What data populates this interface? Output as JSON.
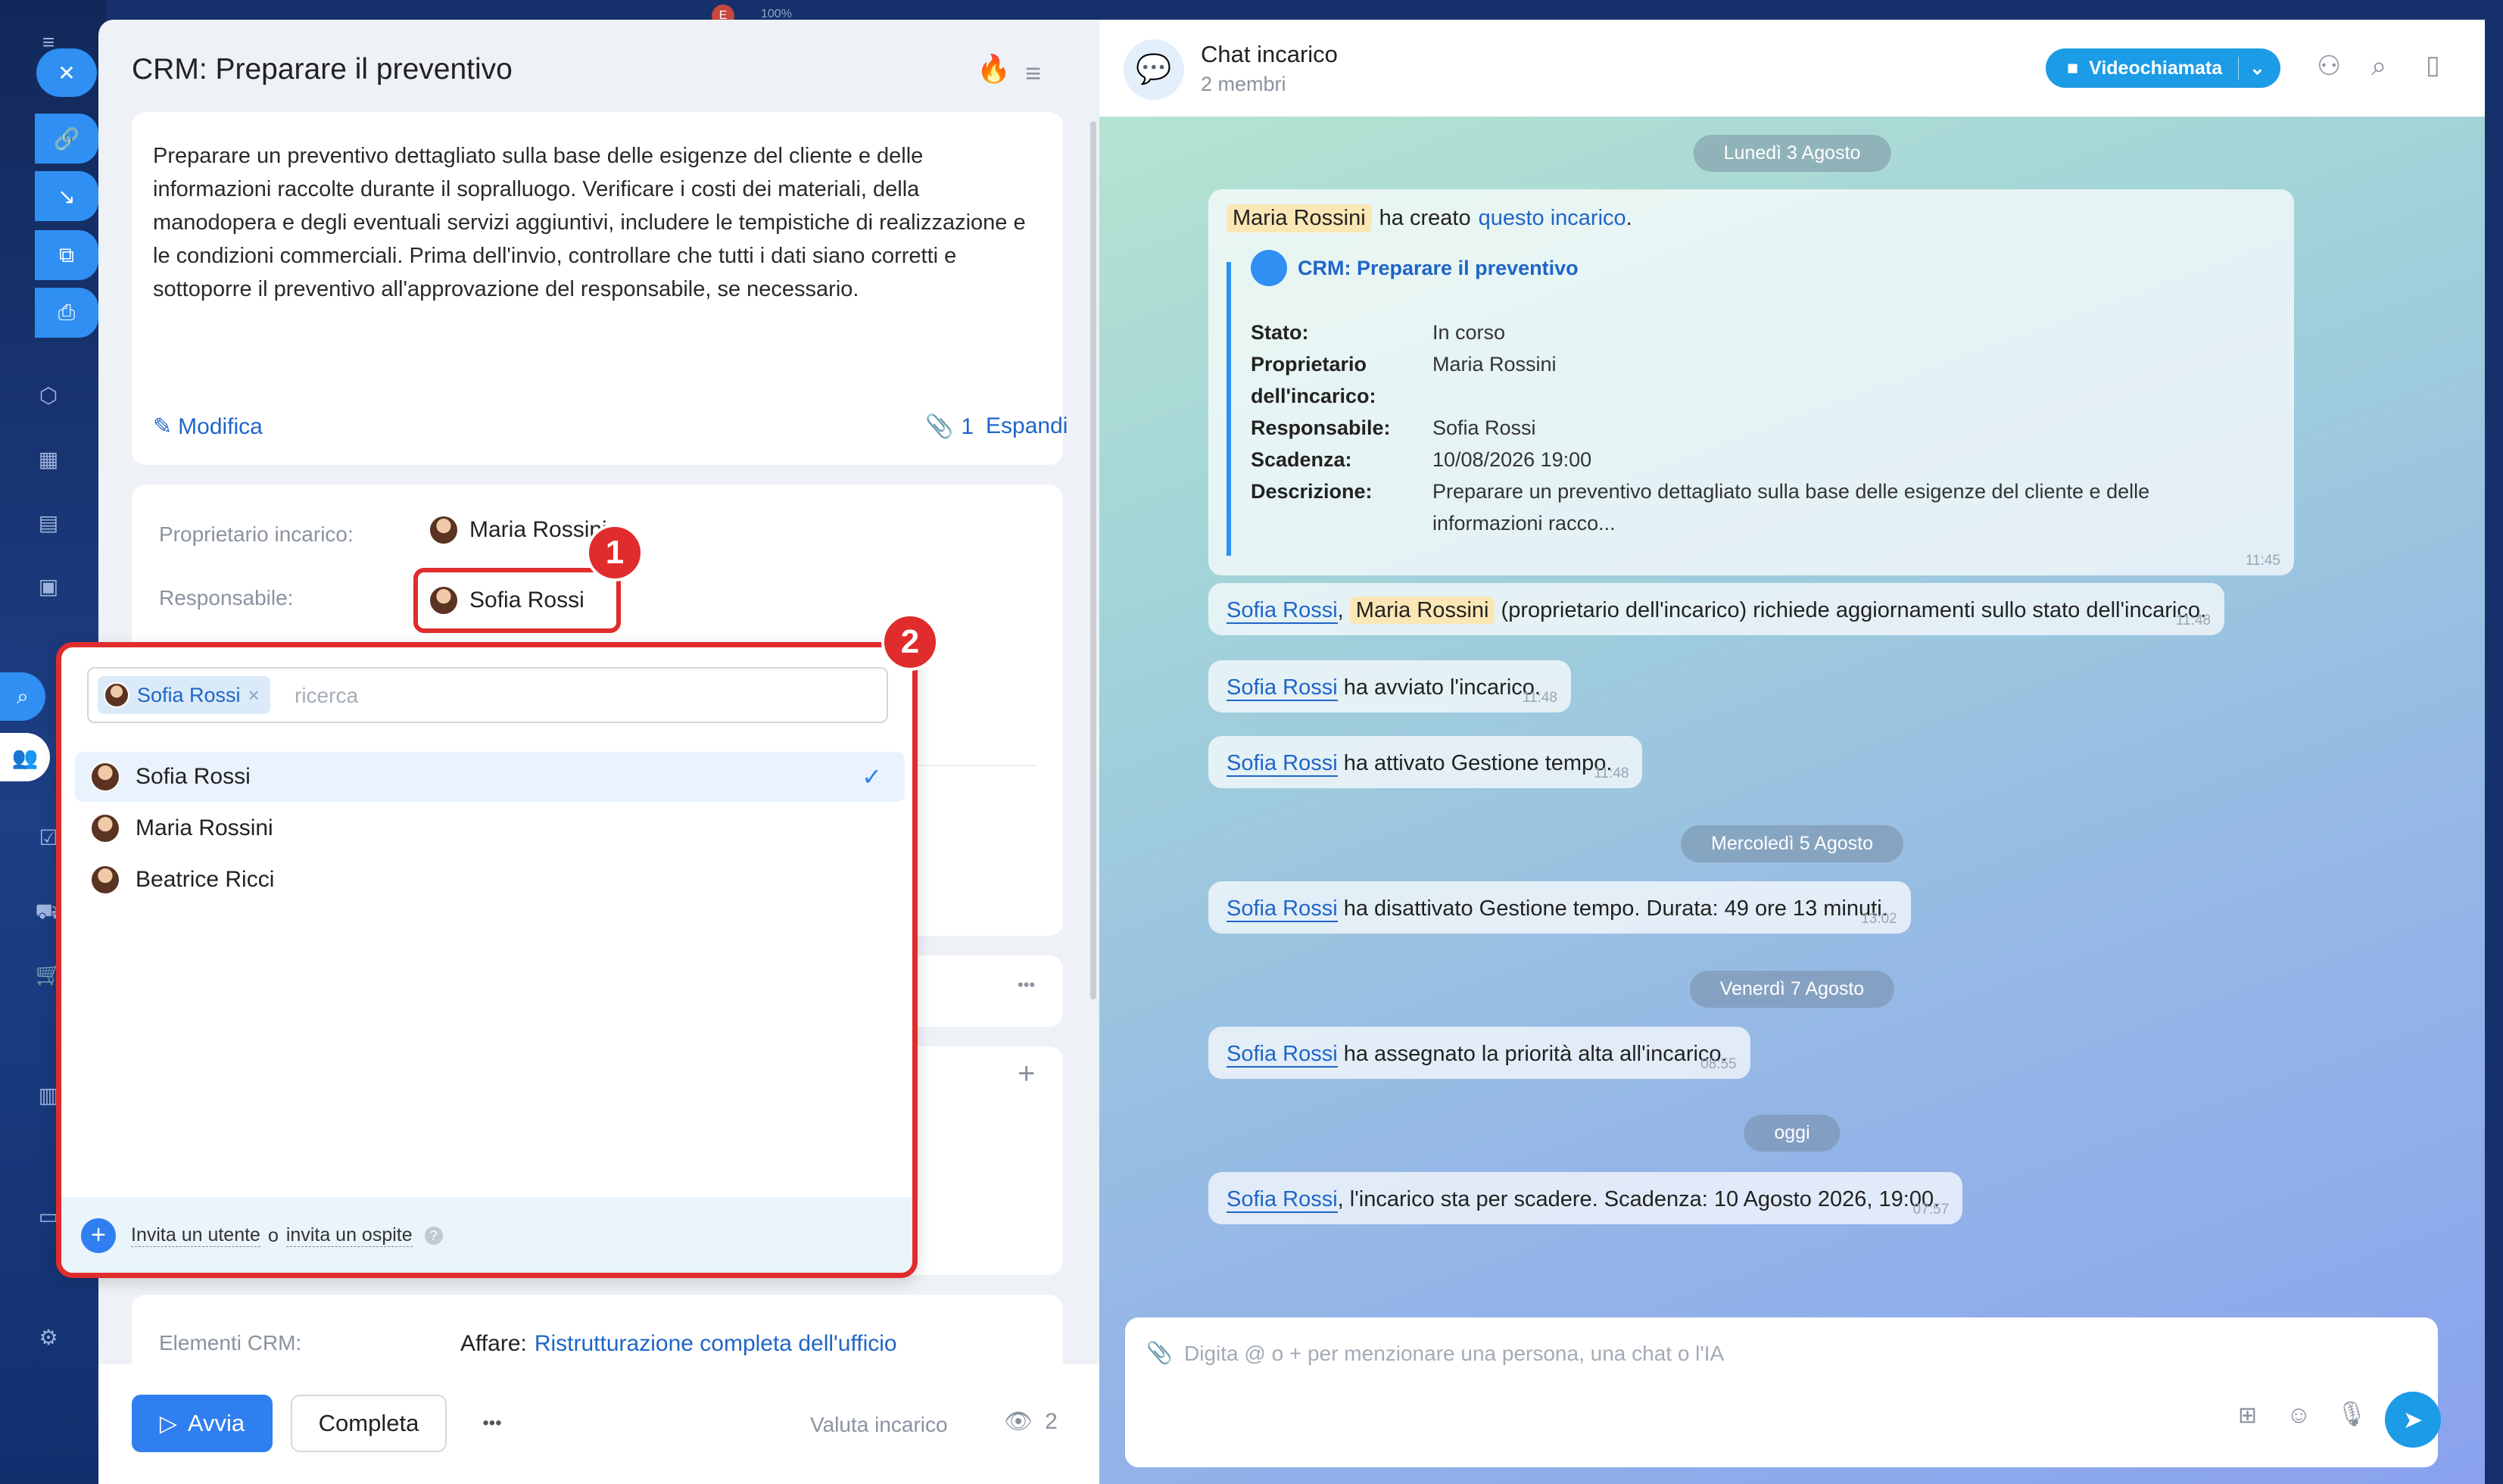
{
  "background": {
    "badge_text": "100%"
  },
  "task": {
    "title": "CRM: Preparare il preventivo",
    "description": "Preparare un preventivo dettagliato sulla base delle esigenze del cliente e delle informazioni raccolte durante il sopralluogo. Verificare i costi dei materiali, della manodopera e degli eventuali servizi aggiuntivi, includere le tempistiche di realizzazione e le condizioni commerciali. Prima dell'invio, controllare che tutti i dati siano corretti e sottoporre il preventivo all'approvazione del responsabile, se necessario.",
    "edit_label": "Modifica",
    "attachments_count": "1",
    "expand_label": "Espandi",
    "owner_label": "Proprietario incarico:",
    "owner_name": "Maria Rossini",
    "assignee_label": "Responsabile:",
    "assignee_name": "Sofia Rossi",
    "crm_label": "Elementi CRM:",
    "crm_prefix": "Affare:",
    "crm_link": "Ristrutturazione completa dell'ufficio",
    "more_dots": "•••",
    "add_symbol": "+"
  },
  "footer": {
    "start_label": "Avvia",
    "complete_label": "Completa",
    "more_label": "•••",
    "rate_label": "Valuta incarico",
    "views_count": "2"
  },
  "dropdown": {
    "selected_chip": "Sofia Rossi",
    "chip_remove": "×",
    "search_placeholder": "ricerca",
    "users": [
      "Sofia Rossi",
      "Maria Rossini",
      "Beatrice Ricci"
    ],
    "selected_index": 0,
    "check": "✓",
    "invite_user": "Invita un utente",
    "invite_or": "o",
    "invite_guest": "invita un ospite",
    "help": "?"
  },
  "annotations": {
    "badge1": "1",
    "badge2": "2"
  },
  "chat": {
    "title": "Chat incarico",
    "subtitle": "2 membri",
    "video_label": "Videochiamata",
    "input_placeholder": "Digita @ o + per menzionare una persona, una chat o l'IA",
    "dates": [
      "Lunedì 3 Agosto",
      "Mercoledì 5 Agosto",
      "Venerdì 7 Agosto",
      "oggi"
    ],
    "created": {
      "who": "Maria Rossini",
      "text": "ha creato",
      "link": "questo incarico",
      "dot": ".",
      "card_title": "CRM: Preparare il preventivo",
      "stato_label": "Stato:",
      "stato": "In corso",
      "owner_label_1": "Proprietario",
      "owner_label_2": "dell'incarico:",
      "owner": "Maria Rossini",
      "resp_label": "Responsabile:",
      "resp": "Sofia Rossi",
      "due_label": "Scadenza:",
      "due": "10/08/2026 19:00",
      "desc_label": "Descrizione:",
      "desc_1": "Preparare un preventivo dettagliato sulla base delle esigenze del cliente e delle",
      "desc_2": "informazioni racco...",
      "time": "11:45"
    },
    "messages": [
      {
        "who": "Sofia Rossi",
        "sep": ",",
        "who2": "Maria Rossini",
        "text": "(proprietario dell'incarico) richiede aggiornamenti sullo stato dell'incarico.",
        "time": "11:48"
      },
      {
        "who": "Sofia Rossi",
        "text": "ha avviato l'incarico.",
        "time": "11:48"
      },
      {
        "who": "Sofia Rossi",
        "text": "ha attivato Gestione tempo.",
        "time": "11:48"
      },
      {
        "who": "Sofia Rossi",
        "text": "ha disattivato Gestione tempo. Durata: 49 ore 13 minuti.",
        "time": "13:02"
      },
      {
        "who": "Sofia Rossi",
        "text": "ha assegnato la priorità alta all'incarico.",
        "time": "08:55"
      },
      {
        "who": "Sofia Rossi",
        "text": ", l'incarico sta per scadere. Scadenza: 10 Agosto 2026, 19:00.",
        "time": "07:57"
      }
    ]
  }
}
